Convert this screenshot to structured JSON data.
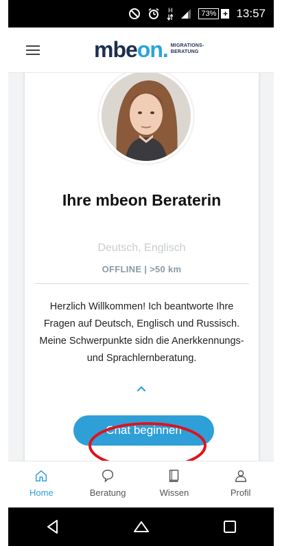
{
  "status_bar": {
    "icons": [
      "do-not-disturb-icon",
      "alarm-icon",
      "network-h-icon",
      "signal-icon"
    ],
    "network_label": "H",
    "battery_percent": "73%",
    "time": "13:57"
  },
  "header": {
    "logo_main_1": "mbe",
    "logo_main_2": "on",
    "logo_dot": ".",
    "logo_sub_1": "MIGRATIONS-",
    "logo_sub_2": "BERATUNG"
  },
  "advisor": {
    "title": "Ihre mbeon Beraterin",
    "languages": "Deutsch, Englisch",
    "status": "OFFLINE | >50 km",
    "description": "Herzlich Willkommen! Ich beantworte Ihre Fragen auf Deutsch, Englisch und Russisch. Meine Schwerpunkte sidn die Anerkkennungs- und Sprachlernberatung.",
    "chat_button": "Chat beginnen"
  },
  "bottom_nav": {
    "items": [
      {
        "label": "Home",
        "icon": "home-icon",
        "active": true
      },
      {
        "label": "Beratung",
        "icon": "chat-bubble-icon",
        "active": false
      },
      {
        "label": "Wissen",
        "icon": "book-icon",
        "active": false
      },
      {
        "label": "Profil",
        "icon": "person-icon",
        "active": false
      }
    ]
  },
  "colors": {
    "accent": "#2f9fd8",
    "brand_dark": "#1d2e4e",
    "highlight": "#e0121b"
  }
}
